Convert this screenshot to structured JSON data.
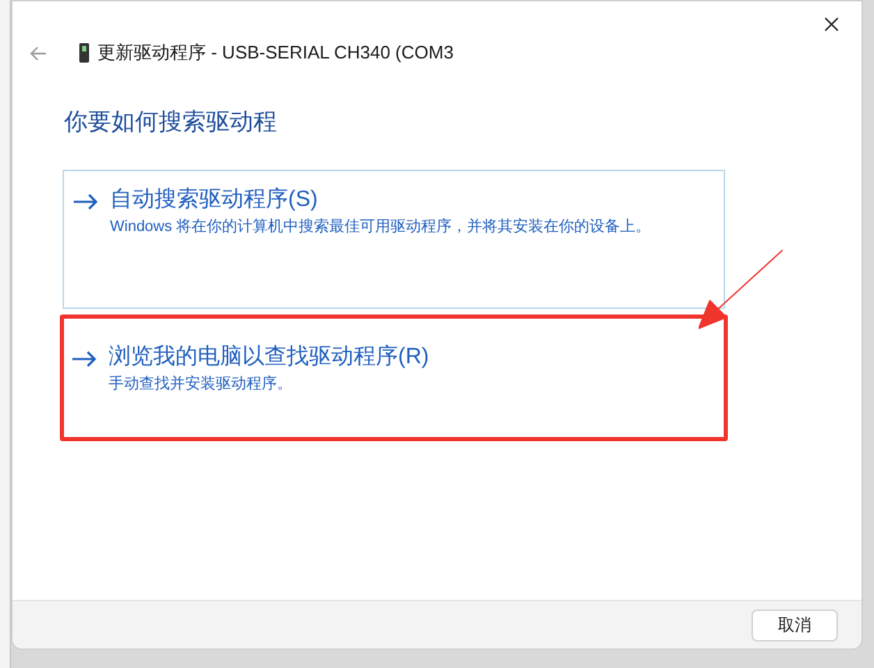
{
  "window": {
    "title": "更新驱动程序 - USB-SERIAL CH340 (COM3"
  },
  "heading": "你要如何搜索驱动程",
  "options": [
    {
      "title": "自动搜索驱动程序(S)",
      "description": "Windows 将在你的计算机中搜索最佳可用驱动程序，并将其安装在你的设备上。",
      "highlighted": false
    },
    {
      "title": "浏览我的电脑以查找驱动程序(R)",
      "description": "手动查找并安装驱动程序。",
      "highlighted": true
    }
  ],
  "buttons": [
    "取消"
  ]
}
